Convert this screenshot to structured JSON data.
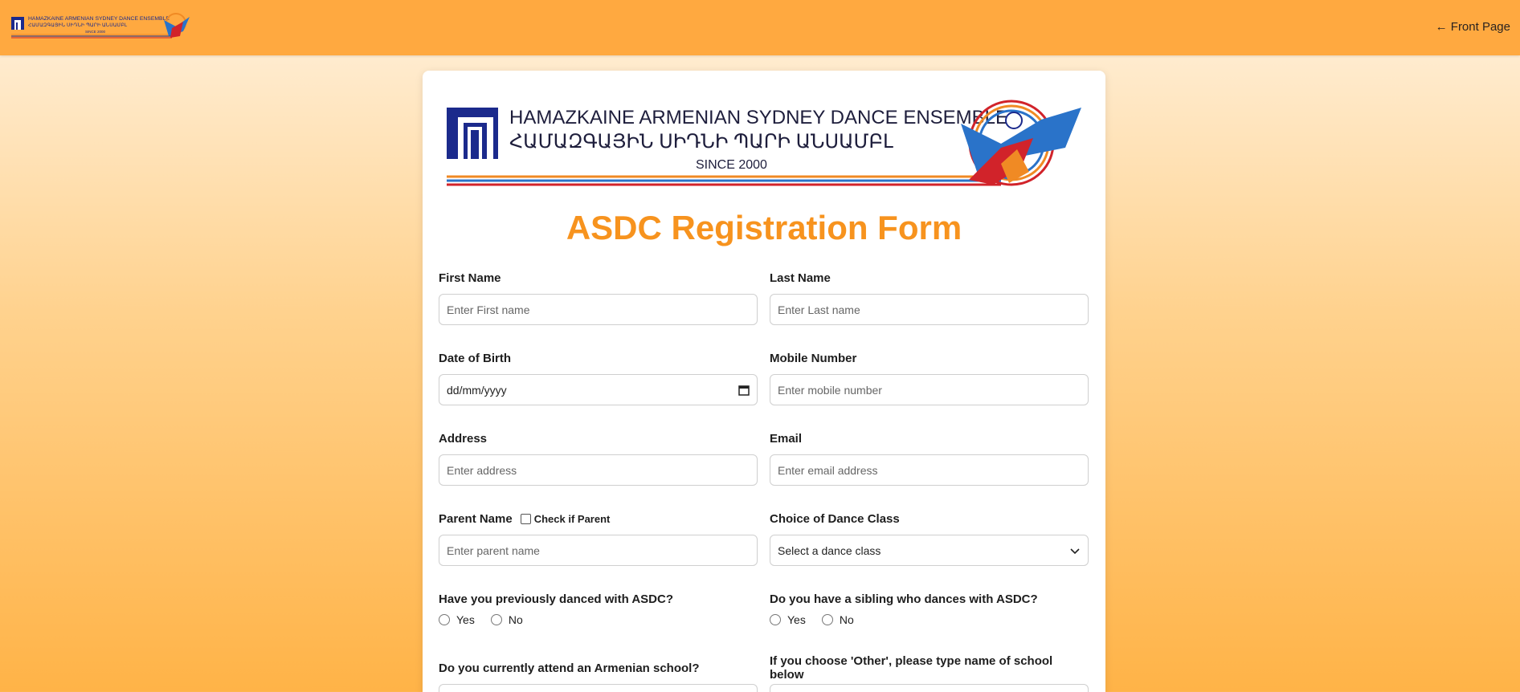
{
  "header": {
    "logo_text_en": "HAMAZKAINE ARMENIAN SYDNEY DANCE ENSEMBLE",
    "logo_text_hy": "ՀԱՄԱԶԳԱՅԻՆ ՍԻԴՆԻ ՊԱՐԻ ԱՆՍԱՄԲԼ",
    "logo_since": "SINCE 2000",
    "front_page_link": "← Front Page"
  },
  "banner": {
    "title_en": "HAMAZKAINE ARMENIAN SYDNEY DANCE ENSEMBLE",
    "title_hy": "ՀԱՄԱԶԳԱՅԻՆ ՍԻԴՆԻ ՊԱՐԻ ԱՆՍԱՄԲԼ",
    "since": "SINCE 2000"
  },
  "form": {
    "title": "ASDC Registration Form",
    "first_name": {
      "label": "First Name",
      "placeholder": "Enter First name"
    },
    "last_name": {
      "label": "Last Name",
      "placeholder": "Enter Last name"
    },
    "dob": {
      "label": "Date of Birth",
      "value": "dd/mm/yyyy"
    },
    "mobile": {
      "label": "Mobile Number",
      "placeholder": "Enter mobile number"
    },
    "address": {
      "label": "Address",
      "placeholder": "Enter address"
    },
    "email": {
      "label": "Email",
      "placeholder": "Enter email address"
    },
    "parent": {
      "label": "Parent Name",
      "checkbox_label": "Check if Parent",
      "placeholder": "Enter parent name"
    },
    "dance_class": {
      "label": "Choice of Dance Class",
      "selected": "Select a dance class"
    },
    "danced_before": {
      "label": "Have you previously danced with ASDC?",
      "options": [
        "Yes",
        "No"
      ]
    },
    "sibling": {
      "label": "Do you have a sibling who dances with ASDC?",
      "options": [
        "Yes",
        "No"
      ]
    },
    "armenian_school": {
      "label": "Do you currently attend an Armenian school?"
    },
    "other_school": {
      "label": "If you choose 'Other', please type name of school below"
    }
  },
  "colors": {
    "accent": "#f7931e",
    "header_bg": "#ffa940",
    "logo_blue": "#1b2a8c",
    "logo_red": "#d1232a",
    "logo_orange": "#f08a24"
  },
  "icons": {
    "calendar": "calendar-icon",
    "dropdown": "chevron-down-icon"
  }
}
